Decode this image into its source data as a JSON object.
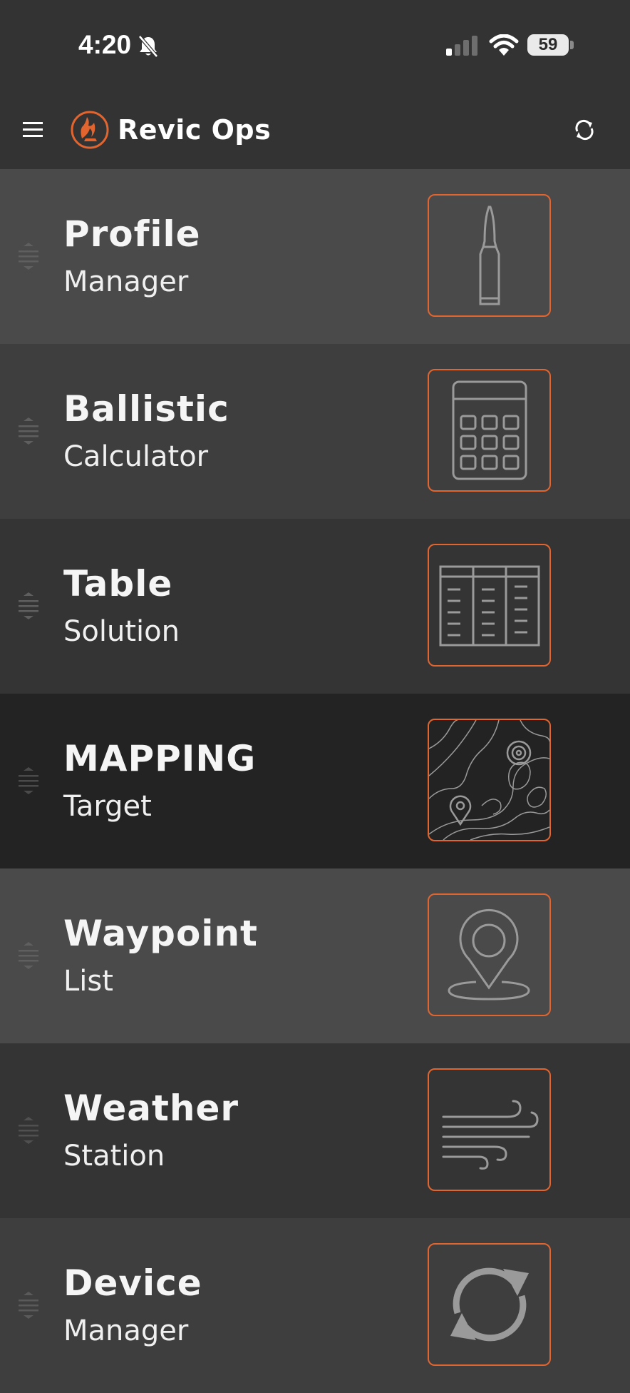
{
  "status_bar": {
    "time": "4:20",
    "battery": "59",
    "icons": [
      "bell-slash-icon",
      "cellular-signal-icon",
      "wifi-icon",
      "battery-icon"
    ]
  },
  "app_bar": {
    "title": "Revic Ops",
    "icons": [
      "menu-icon",
      "revic-logo-icon",
      "sync-icon"
    ]
  },
  "colors": {
    "accent": "#e2652f",
    "row_backgrounds": [
      "#4a4a4a",
      "#3e3e3e",
      "#343434",
      "#232323",
      "#4a4a4a",
      "#343434",
      "#3e3e3e"
    ]
  },
  "menu_items": [
    {
      "title": "Profile",
      "subtitle": "Manager",
      "icon": "bullet-cartridge-icon"
    },
    {
      "title": "Ballistic",
      "subtitle": "Calculator",
      "icon": "calculator-icon"
    },
    {
      "title": "Table",
      "subtitle": "Solution",
      "icon": "table-icon"
    },
    {
      "title": "MAPPING",
      "subtitle": "Target",
      "icon": "topo-map-icon"
    },
    {
      "title": "Waypoint",
      "subtitle": "List",
      "icon": "location-pin-icon"
    },
    {
      "title": "Weather",
      "subtitle": "Station",
      "icon": "wind-icon"
    },
    {
      "title": "Device",
      "subtitle": "Manager",
      "icon": "device-sync-icon"
    }
  ]
}
